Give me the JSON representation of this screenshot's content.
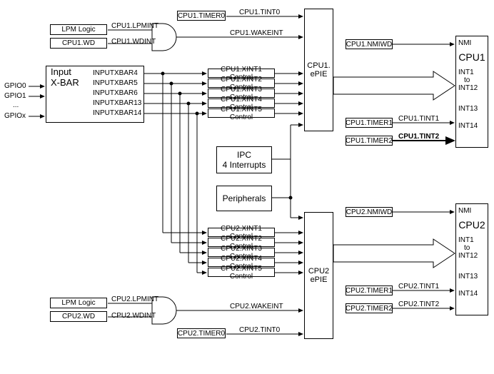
{
  "gpio": {
    "g0": "GPIO0",
    "g1": "GPIO1",
    "dots": "...",
    "gx": "GPIOx"
  },
  "xbar": {
    "title_a": "Input",
    "title_b": "X-BAR",
    "out4": "INPUTXBAR4",
    "out5": "INPUTXBAR5",
    "out6": "INPUTXBAR6",
    "out13": "INPUTXBAR13",
    "out14": "INPUTXBAR14"
  },
  "lpm1": {
    "lpm": "LPM  Logic",
    "wd": "CPU1.WD",
    "lpmint": "CPU1.LPMINT",
    "wdint": "CPU1.WDINT"
  },
  "lpm2": {
    "lpm": "LPM  Logic",
    "wd": "CPU2.WD",
    "lpmint": "CPU2.LPMINT",
    "wdint": "CPU2.WDINT"
  },
  "timers": {
    "c1t0": "CPU1.TIMER0",
    "c1t0s": "CPU1.TINT0",
    "c1wake": "CPU1.WAKEINT",
    "c1t1": "CPU1.TIMER1",
    "c1t1s": "CPU1.TINT1",
    "c1t2": "CPU1.TIMER2",
    "c1t2s": "CPU1.TINT2",
    "c2t0": "CPU2.TIMER0",
    "c2t0s": "CPU2.TINT0",
    "c2wake": "CPU2.WAKEINT",
    "c2t1": "CPU2.TIMER1",
    "c2t1s": "CPU2.TINT1",
    "c2t2": "CPU2.TIMER2",
    "c2t2s": "CPU2.TINT2",
    "c1nmi": "CPU1.NMIWD",
    "c2nmi": "CPU2.NMIWD"
  },
  "xint1": {
    "x1": "CPU1.XINT1 Control",
    "x2": "CPU1.XINT2 Control",
    "x3": "CPU1.XINT3 Control",
    "x4": "CPU1.XINT4 Control",
    "x5": "CPU1.XINT5 Control"
  },
  "xint2": {
    "x1": "CPU2.XINT1 Control",
    "x2": "CPU2.XINT2 Control",
    "x3": "CPU2.XINT3 Control",
    "x4": "CPU2.XINT4 Control",
    "x5": "CPU2.XINT5 Control"
  },
  "middle": {
    "ipc_a": "IPC",
    "ipc_b": "4 Interrupts",
    "periph": "Peripherals"
  },
  "epie": {
    "c1a": "CPU1.",
    "c1b": "ePIE",
    "c2a": "CPU2",
    "c2b": "ePIE"
  },
  "cpu": {
    "c1": "CPU1",
    "c2": "CPU2",
    "nmi": "NMI",
    "int1": "INT1",
    "to": "to",
    "int12": "INT12",
    "int13": "INT13",
    "int14": "INT14"
  }
}
